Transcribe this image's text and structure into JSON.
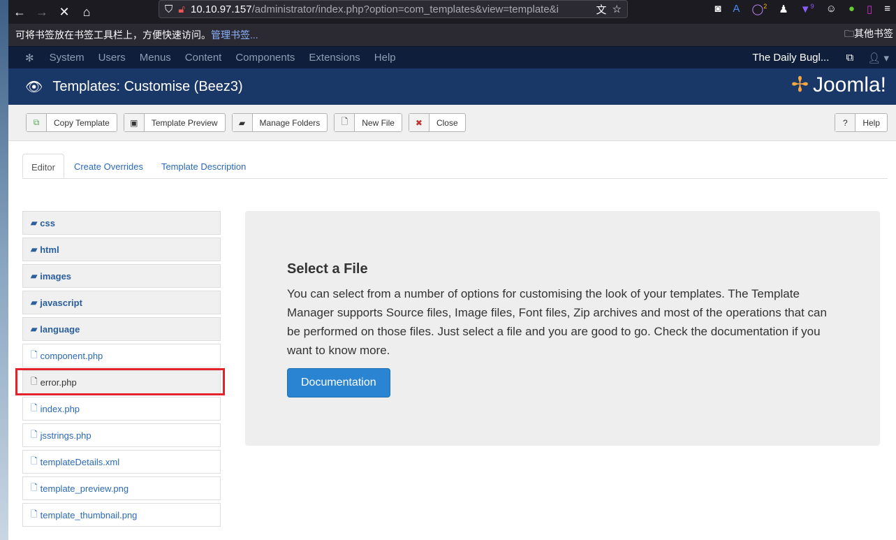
{
  "browser": {
    "url_host": "10.10.97.157",
    "url_path": "/administrator/index.php?option=com_templates&view=template&i",
    "bookmarks_hint": "可将书签放在书签工具栏上，方便快速访问。",
    "manage_bookmarks": "管理书签...",
    "other_bookmarks": "其他书签",
    "badge_a": "2",
    "badge_b": "9"
  },
  "menu": {
    "items": [
      "System",
      "Users",
      "Menus",
      "Content",
      "Components",
      "Extensions",
      "Help"
    ],
    "site": "The Daily Bugl..."
  },
  "header": {
    "title": "Templates: Customise (Beez3)",
    "logo": "Joomla!"
  },
  "toolbar": {
    "copy": "Copy Template",
    "preview": "Template Preview",
    "folders": "Manage Folders",
    "newfile": "New File",
    "close": "Close",
    "help": "Help"
  },
  "tabs": [
    "Editor",
    "Create Overrides",
    "Template Description"
  ],
  "folders": [
    "css",
    "html",
    "images",
    "javascript",
    "language"
  ],
  "files": [
    "component.php",
    "error.php",
    "index.php",
    "jsstrings.php",
    "templateDetails.xml",
    "template_preview.png",
    "template_thumbnail.png"
  ],
  "panel": {
    "title": "Select a File",
    "text": "You can select from a number of options for customising the look of your templates. The Template Manager supports Source files, Image files, Font files, Zip archives and most of the operations that can be performed on those files. Just select a file and you are good to go. Check the documentation if you want to know more.",
    "button": "Documentation"
  }
}
